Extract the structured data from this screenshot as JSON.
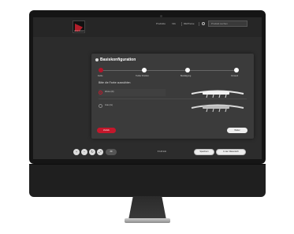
{
  "topbar": {
    "logo_text": "MÜNCHENER",
    "nav": [
      "Produkte",
      "Info",
      "DE/Preise"
    ],
    "search_placeholder": "Produkt suchen"
  },
  "dialog": {
    "title": "Basiskonfiguration",
    "steps": [
      {
        "label": "Farbe",
        "active": true
      },
      {
        "label": "Treffer Position",
        "active": false
      },
      {
        "label": "Bestätigung",
        "active": false
      },
      {
        "label": "Versand",
        "active": false
      }
    ],
    "section_title": "Bitte die Farbe auswählen",
    "options": [
      {
        "label": "Weiss (W)",
        "selected": true
      },
      {
        "label": "Grau (G)",
        "selected": false
      }
    ],
    "back_button": "Zurück",
    "next_button": "Weiter"
  },
  "bottombar": {
    "round_icons": [
      "zoom-in-icon",
      "zoom-out-icon",
      "rotate-icon",
      "fullscreen-icon"
    ],
    "view_button": "3D",
    "summary": "€ 120 inkl.",
    "save_button": "Speichern",
    "cart_button": "In den Warenkorb"
  },
  "colors": {
    "accent": "#c4172b",
    "screen_bg": "#2c2c2c",
    "dialog_bg": "#3b3b3b"
  }
}
